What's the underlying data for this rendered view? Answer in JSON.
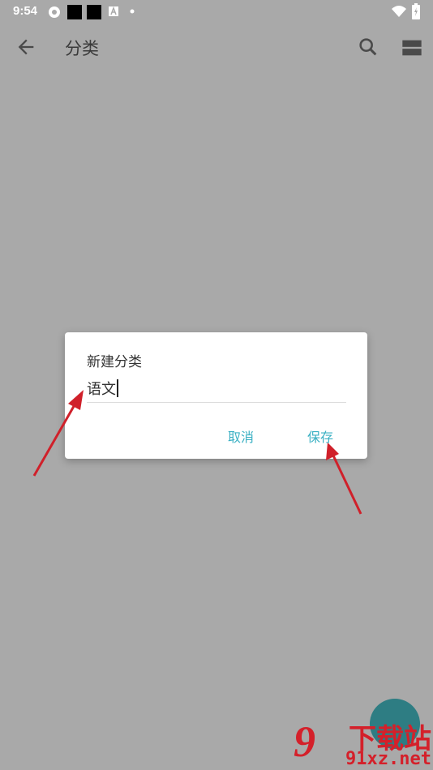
{
  "status_bar": {
    "time": "9:54"
  },
  "app_bar": {
    "title": "分类",
    "icons": [
      "back-arrow-icon",
      "search-icon",
      "view-toggle-icon"
    ]
  },
  "dialog": {
    "title": "新建分类",
    "input_value": "语文",
    "cancel_label": "取消",
    "save_label": "保存",
    "accent_color": "#3ab0c3"
  },
  "watermark": {
    "line1": "下载站",
    "line2": "91xz.net"
  },
  "colors": {
    "scrim": "#a9a9a9",
    "annotation_arrow": "#d0202a"
  }
}
